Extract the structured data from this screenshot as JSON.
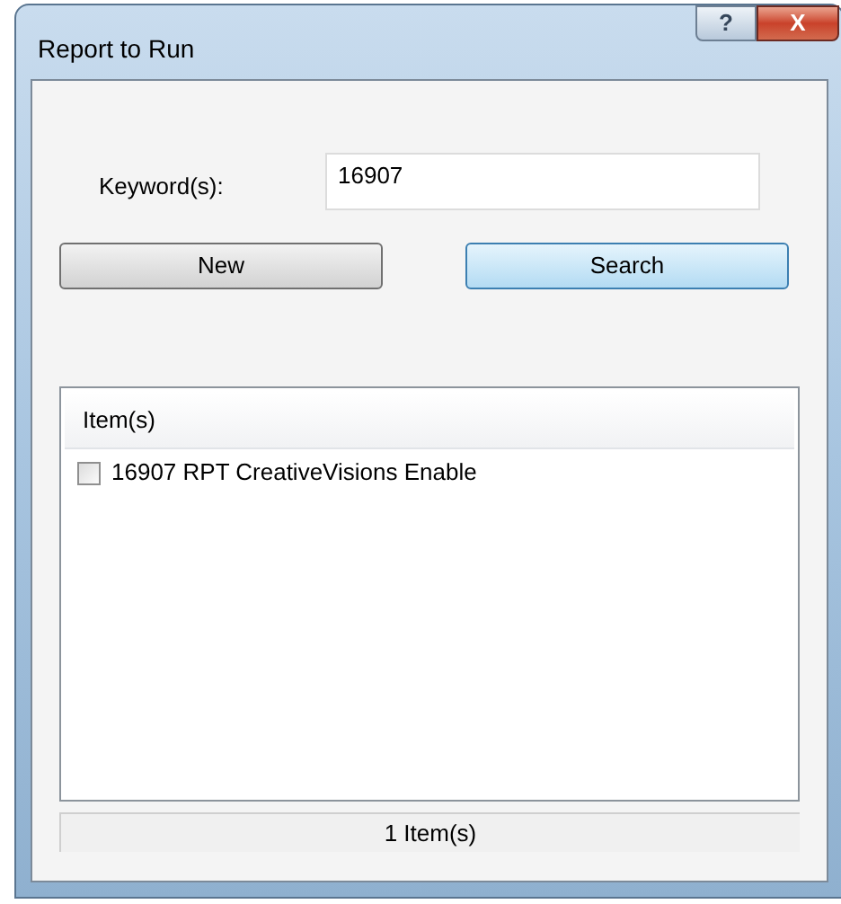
{
  "window": {
    "title": "Report to Run",
    "help_button": "?",
    "close_button": "X"
  },
  "keyword": {
    "label": "Keyword(s):",
    "value": "16907"
  },
  "buttons": [
    {
      "label": "New",
      "focused": false
    },
    {
      "label": "Search",
      "focused": true
    }
  ],
  "list": {
    "header": "Item(s)",
    "items": [
      {
        "label": "16907 RPT CreativeVisions Enable",
        "checked": false
      }
    ]
  },
  "status_bar": "1 Item(s)"
}
